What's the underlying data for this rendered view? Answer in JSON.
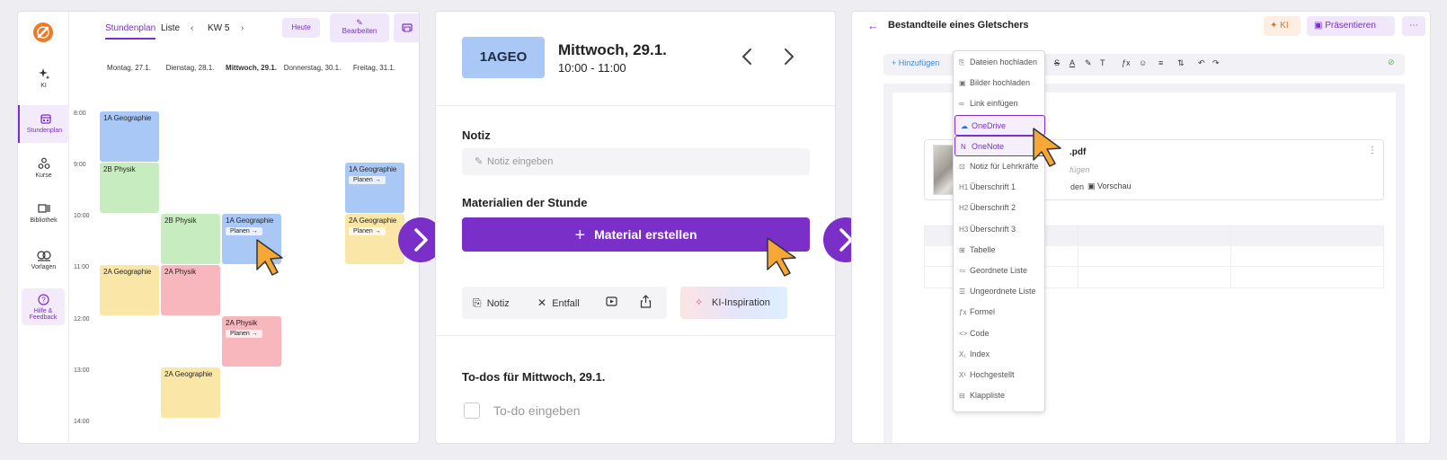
{
  "colors": {
    "accent": "#7b2fc9",
    "event_blue": "#aac8f5",
    "event_green": "#c7ecbf",
    "event_yellow": "#fae6a6",
    "event_red": "#f8b6bd",
    "cursor": "#f7a736"
  },
  "panel1": {
    "sidebar": [
      {
        "label": "KI",
        "icon": "ai-sparkle-icon"
      },
      {
        "label": "Stundenplan",
        "icon": "calendar-icon"
      },
      {
        "label": "Kurse",
        "icon": "courses-icon"
      },
      {
        "label": "Bibliothek",
        "icon": "library-icon"
      },
      {
        "label": "Vorlagen",
        "icon": "templates-icon"
      },
      {
        "label": "Hilfe &",
        "label2": "Feedback",
        "icon": "help-icon"
      }
    ],
    "tabs": {
      "schedule": "Stundenplan",
      "list": "Liste"
    },
    "week": "KW 5",
    "today": "Heute",
    "edit": "Bearbeiten",
    "days": [
      "Montag, 27.1.",
      "Dienstag, 28.1.",
      "Mittwoch, 29.1.",
      "Donnerstag, 30.1.",
      "Freitag, 31.1."
    ],
    "times": [
      "8:00",
      "9:00",
      "10:00",
      "11:00",
      "12:00",
      "13:00",
      "14:00"
    ],
    "events": [
      {
        "title": "1A Geographie",
        "color": "blue"
      },
      {
        "title": "2B Physik",
        "color": "green"
      },
      {
        "title": "1A Geographie",
        "color": "blue",
        "plan": "Planen"
      },
      {
        "title": "2B Physik",
        "color": "green"
      },
      {
        "title": "1A Geographie",
        "color": "blue",
        "plan": "Planen"
      },
      {
        "title": "2A Geographie",
        "color": "yellow",
        "plan": "Planen"
      },
      {
        "title": "2A Geographie",
        "color": "yellow"
      },
      {
        "title": "2A Physik",
        "color": "red"
      },
      {
        "title": "2A Physik",
        "color": "red",
        "plan": "Planen"
      },
      {
        "title": "2A Geographie",
        "color": "yellow"
      }
    ]
  },
  "panel2": {
    "code": "1AGEO",
    "title": "Mittwoch, 29.1.",
    "time": "10:00 - 11:00",
    "notiz_label": "Notiz",
    "notiz_placeholder": "Notiz eingeben",
    "materials_label": "Materialien der Stunde",
    "create_material": "Material erstellen",
    "tools": {
      "notiz": "Notiz",
      "entfall": "Entfall"
    },
    "ki_inspiration": "KI-Inspiration",
    "todos_label": "To-dos für Mittwoch, 29.1.",
    "todo_placeholder": "To-do eingeben"
  },
  "panel3": {
    "title": "Bestandteile eines Gletschers",
    "ki": "KI",
    "present": "Präsentieren",
    "add": "Hinzufügen",
    "file_name": ".pdf",
    "file_sub": "fügen",
    "file_note_tail": "den",
    "preview": "Vorschau",
    "menu": [
      {
        "label": "Dateien hochladen",
        "glyph": "⎘"
      },
      {
        "label": "Bilder hochladen",
        "glyph": "▣"
      },
      {
        "label": "Link einfügen",
        "glyph": "∞"
      },
      {
        "label": "OneDrive",
        "glyph": "☁"
      },
      {
        "label": "OneNote",
        "glyph": "N"
      },
      {
        "label": "Notiz für Lehrkräfte",
        "glyph": "⊡"
      },
      {
        "label": "Überschrift 1",
        "glyph": "H1"
      },
      {
        "label": "Überschrift 2",
        "glyph": "H2"
      },
      {
        "label": "Überschrift 3",
        "glyph": "H3"
      },
      {
        "label": "Tabelle",
        "glyph": "⊞"
      },
      {
        "label": "Geordnete Liste",
        "glyph": "≔"
      },
      {
        "label": "Ungeordnete Liste",
        "glyph": "☰"
      },
      {
        "label": "Formel",
        "glyph": "ƒx"
      },
      {
        "label": "Code",
        "glyph": "<>"
      },
      {
        "label": "Index",
        "glyph": "X₁"
      },
      {
        "label": "Hochgestellt",
        "glyph": "X¹"
      },
      {
        "label": "Klappliste",
        "glyph": "⊟"
      }
    ]
  }
}
